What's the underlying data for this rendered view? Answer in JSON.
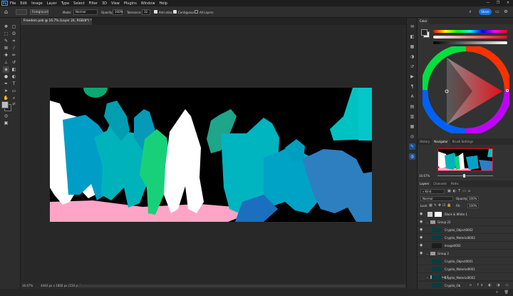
{
  "app": {
    "logo": "Ps"
  },
  "menu": {
    "items": [
      "File",
      "Edit",
      "Image",
      "Layer",
      "Type",
      "Select",
      "Filter",
      "3D",
      "View",
      "Plugins",
      "Window",
      "Help"
    ],
    "window_controls": [
      "—",
      "❐",
      "✕"
    ]
  },
  "options": {
    "preset": "Foreground",
    "mode_label": "Mode:",
    "mode_value": "Normal",
    "opacity_label": "Opacity:",
    "opacity_value": "100%",
    "tolerance_label": "Tolerance:",
    "tolerance_value": "32",
    "antialias_label": "Anti-alias",
    "contiguous_label": "Contiguous",
    "all_layers_label": "All Layers",
    "share_label": "Share"
  },
  "document": {
    "tab_title": "Freedom.psb @ 16.7% (Layer 24, RGB/8*) *",
    "zoom": "16.67%",
    "info": "4440 px x 1860 px (150 ppi)"
  },
  "color_panel": {
    "tab": "Color",
    "fg_color": "#262626",
    "bg_color": "#e6e6e6",
    "accent": "#e0101a"
  },
  "navigator": {
    "tabs": [
      "History",
      "Navigator",
      "Brush Settings"
    ],
    "zoom": "16.67%"
  },
  "layers_panel": {
    "tabs": [
      "Layers",
      "Channels",
      "Paths"
    ],
    "filter": "Kind",
    "blend_mode": "Normal",
    "opacity_label": "Opacity:",
    "opacity_value": "100%",
    "lock_label": "Lock:",
    "fill_label": "Fill:",
    "fill_value": "100%",
    "layers": [
      {
        "name": "Black & White 1",
        "type": "adjustment"
      },
      {
        "name": "Group 22",
        "type": "group"
      },
      {
        "name": "Cryptio_Object0002",
        "type": "layer"
      },
      {
        "name": "Cryptio_Material0002",
        "type": "layer"
      },
      {
        "name": "Image0002",
        "type": "layer"
      },
      {
        "name": "Group 2",
        "type": "group"
      },
      {
        "name": "Cryptio_Object0001",
        "type": "layer"
      },
      {
        "name": "Cryptio_Material0001",
        "type": "layer"
      },
      {
        "name": "Group 1",
        "type": "group"
      },
      {
        "name": "Cryptio_Material0002",
        "type": "layer"
      },
      {
        "name": "Cryptio_Object0002",
        "type": "layer"
      }
    ]
  }
}
